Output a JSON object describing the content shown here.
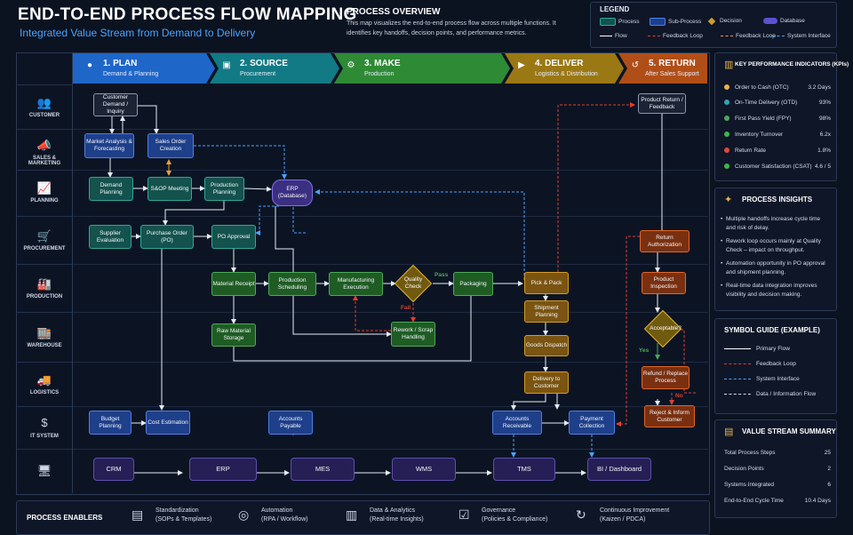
{
  "header": {
    "title": "END-TO-END PROCESS FLOW MAPPING",
    "subtitle": "Integrated Value Stream from Demand to Delivery",
    "overview_title": "PROCESS OVERVIEW",
    "overview_text": "This map visualizes the end-to-end process flow across multiple functions. It identifies key handoffs, decision points, and performance metrics."
  },
  "legend": {
    "title": "LEGEND",
    "items": [
      "Process",
      "Sub-Process",
      "Decision",
      "Database",
      "Flow",
      "Feedback Loop",
      "Feedback Loop",
      "System Interface"
    ],
    "colors": {
      "process": "#14524d",
      "subprocess": "#1e3f8a",
      "decision": "#d49b28",
      "database": "#5d4fd0"
    }
  },
  "phases": [
    {
      "title": "1. PLAN",
      "sub": "Demand & Planning",
      "color": "#1f66c9",
      "icon": "people-icon"
    },
    {
      "title": "2. SOURCE",
      "sub": "Procurement",
      "color": "#127a84",
      "icon": "monitor-icon"
    },
    {
      "title": "3. MAKE",
      "sub": "Production",
      "color": "#2e8a35",
      "icon": "gears-icon"
    },
    {
      "title": "4. DELIVER",
      "sub": "Logistics & Distribution",
      "color": "#9a7814",
      "icon": "truck-icon"
    },
    {
      "title": "5. RETURN",
      "sub": "After Sales Support",
      "color": "#b04e18",
      "icon": "return-icon"
    }
  ],
  "lanes": [
    {
      "label": "CUSTOMER",
      "icon": "👥"
    },
    {
      "label": "SALES & MARKETING",
      "icon": "📣"
    },
    {
      "label": "PLANNING",
      "icon": "📈"
    },
    {
      "label": "PROCUREMENT",
      "icon": "🛒"
    },
    {
      "label": "PRODUCTION",
      "icon": "🏭"
    },
    {
      "label": "WAREHOUSE",
      "icon": "🏬"
    },
    {
      "label": "LOGISTICS",
      "icon": "🚚"
    },
    {
      "label": "IT SYSTEM",
      "icon": "$"
    },
    {
      "label": "",
      "icon": "🖥"
    }
  ],
  "nodes": {
    "customer_demand": "Customer Demand / Inquiry",
    "market_analysis": "Market Analysis & Forecasting",
    "sales_order": "Sales Order Creation",
    "demand_planning": "Demand Planning",
    "sop": "S&OP Meeting",
    "production_planning": "Production Planning",
    "erp_db": "ERP (Database)",
    "supplier_eval": "Supplier Evaluation",
    "purchase_order": "Purchase Order (PO)",
    "po_approval": "PO Approval",
    "material_receipt": "Material Receipt",
    "production_scheduling": "Production Scheduling",
    "manufacturing_exec": "Manufacturing Execution",
    "quality_check": "Quality Check",
    "pass": "Pass",
    "fail": "Fail",
    "packaging": "Packaging",
    "raw_material": "Raw Material Storage",
    "rework": "Rework / Scrap Handling",
    "pick_pack": "Pick & Pack",
    "shipment_planning": "Shipment Planning",
    "goods_dispatch": "Goods Dispatch",
    "delivery": "Delivery to Customer",
    "product_return": "Product Return / Feedback",
    "return_auth": "Return Authorization",
    "product_inspection": "Product Inspection",
    "acceptable": "Acceptable?",
    "yes": "Yes",
    "no": "No",
    "refund": "Refund / Replace Process",
    "reject": "Reject & Inform Customer",
    "budget_planning": "Budget Planning",
    "cost_estimation": "Cost Estimation",
    "accounts_payable": "Accounts Payable",
    "accounts_receivable": "Accounts Receivable",
    "payment_collection": "Payment Collection"
  },
  "systems": [
    "CRM",
    "ERP",
    "MES",
    "WMS",
    "TMS",
    "BI / Dashboard"
  ],
  "kpi": {
    "title": "KEY PERFORMANCE INDICATORS (KPIs)",
    "items": [
      {
        "label": "Order to Cash (OTC)",
        "value": "3.2 Days",
        "color": "#e8b04a"
      },
      {
        "label": "On-Time Delivery (OTD)",
        "value": "93%",
        "color": "#2fa7b0"
      },
      {
        "label": "First Pass Yield (FPY)",
        "value": "98%",
        "color": "#4ea85a"
      },
      {
        "label": "Inventory Turnover",
        "value": "6.2x",
        "color": "#3fb54a"
      },
      {
        "label": "Return Rate",
        "value": "1.8%",
        "color": "#e04a3a"
      },
      {
        "label": "Customer Satisfaction (CSAT)",
        "value": "4.6 / 5",
        "color": "#3fb54a"
      }
    ]
  },
  "insights": {
    "title": "PROCESS INSIGHTS",
    "items": [
      "Multiple handoffs increase cycle time and risk of delay.",
      "Rework loop occurs mainly at Quality Check – impact on throughput.",
      "Automation opportunity in PO approval and shipment planning.",
      "Real-time data integration improves visibility and decision making."
    ]
  },
  "symbols": {
    "title": "SYMBOL GUIDE (EXAMPLE)",
    "items": [
      "Primary Flow",
      "Feedback Loop",
      "System Interface",
      "Data / Information Flow"
    ]
  },
  "vss": {
    "title": "VALUE STREAM SUMMARY",
    "items": [
      {
        "label": "Total Process Steps",
        "value": "25"
      },
      {
        "label": "Decision Points",
        "value": "2"
      },
      {
        "label": "Systems Integrated",
        "value": "6"
      },
      {
        "label": "End-to-End Cycle Time",
        "value": "10.4 Days"
      }
    ]
  },
  "enablers": {
    "title": "PROCESS ENABLERS",
    "items": [
      {
        "l1": "Standardization",
        "l2": "(SOPs & Templates)",
        "icon": "document-icon"
      },
      {
        "l1": "Automation",
        "l2": "(RPA / Workflow)",
        "icon": "robot-icon"
      },
      {
        "l1": "Data & Analytics",
        "l2": "(Real-time Insights)",
        "icon": "chart-icon"
      },
      {
        "l1": "Governance",
        "l2": "(Policies & Compliance)",
        "icon": "checklist-icon"
      },
      {
        "l1": "Continuous Improvement",
        "l2": "(Kaizen / PDCA)",
        "icon": "cycle-icon"
      }
    ]
  }
}
